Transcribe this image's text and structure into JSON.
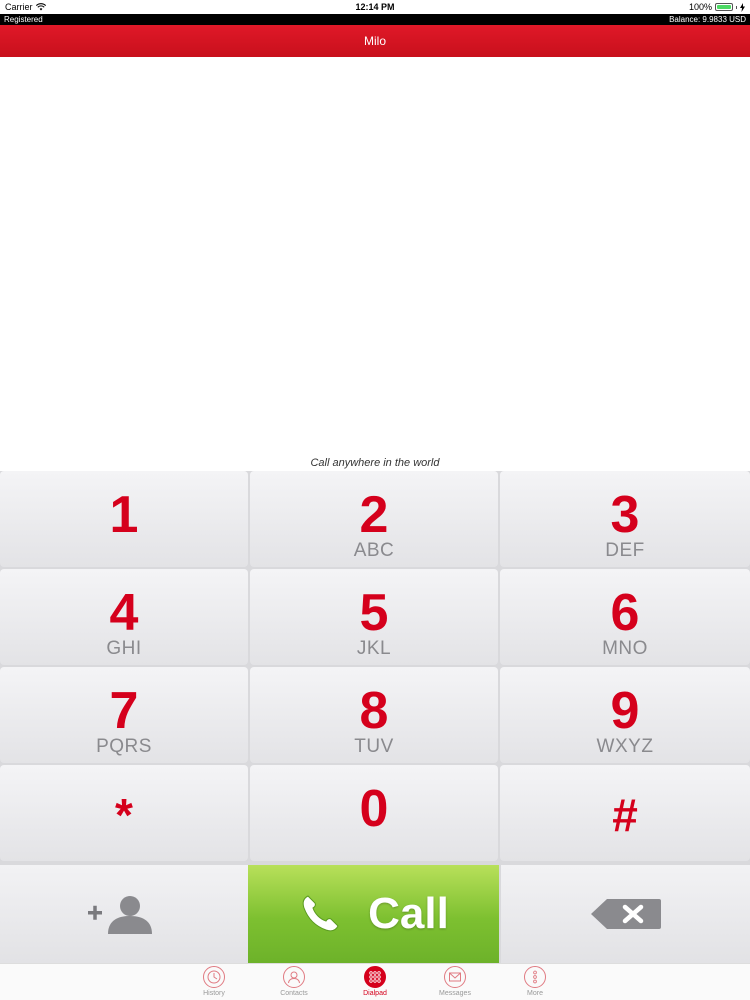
{
  "status_bar": {
    "carrier": "Carrier",
    "time": "12:14 PM",
    "battery_percent": "100%",
    "battery_level": 1.0,
    "icons": [
      "wifi-icon",
      "battery-icon",
      "charging-bolt-icon"
    ]
  },
  "info_bar": {
    "registration": "Registered",
    "balance": "Balance: 9.9833 USD"
  },
  "header": {
    "title": "Milo",
    "accent_color": "#d5001c"
  },
  "display": {
    "number": "",
    "tagline": "Call anywhere in the world"
  },
  "keypad": {
    "keys": [
      {
        "digit": "1",
        "letters": ""
      },
      {
        "digit": "2",
        "letters": "ABC"
      },
      {
        "digit": "3",
        "letters": "DEF"
      },
      {
        "digit": "4",
        "letters": "GHI"
      },
      {
        "digit": "5",
        "letters": "JKL"
      },
      {
        "digit": "6",
        "letters": "MNO"
      },
      {
        "digit": "7",
        "letters": "PQRS"
      },
      {
        "digit": "8",
        "letters": "TUV"
      },
      {
        "digit": "9",
        "letters": "WXYZ"
      },
      {
        "digit": "*",
        "letters": ""
      },
      {
        "digit": "0",
        "letters": ""
      },
      {
        "digit": "#",
        "letters": ""
      }
    ],
    "digit_color": "#d5001c"
  },
  "actions": {
    "add_contact_icon": "add-contact-icon",
    "call_label": "Call",
    "call_icon": "phone-handset-icon",
    "call_color": "#7dc030",
    "backspace_icon": "backspace-icon"
  },
  "tab_bar": {
    "tabs": [
      {
        "label": "History",
        "icon": "clock-icon",
        "active": false
      },
      {
        "label": "Contacts",
        "icon": "person-icon",
        "active": false
      },
      {
        "label": "Dialpad",
        "icon": "dialpad-icon",
        "active": true
      },
      {
        "label": "Messages",
        "icon": "envelope-icon",
        "active": false
      },
      {
        "label": "More",
        "icon": "more-dots-icon",
        "active": false
      }
    ]
  }
}
